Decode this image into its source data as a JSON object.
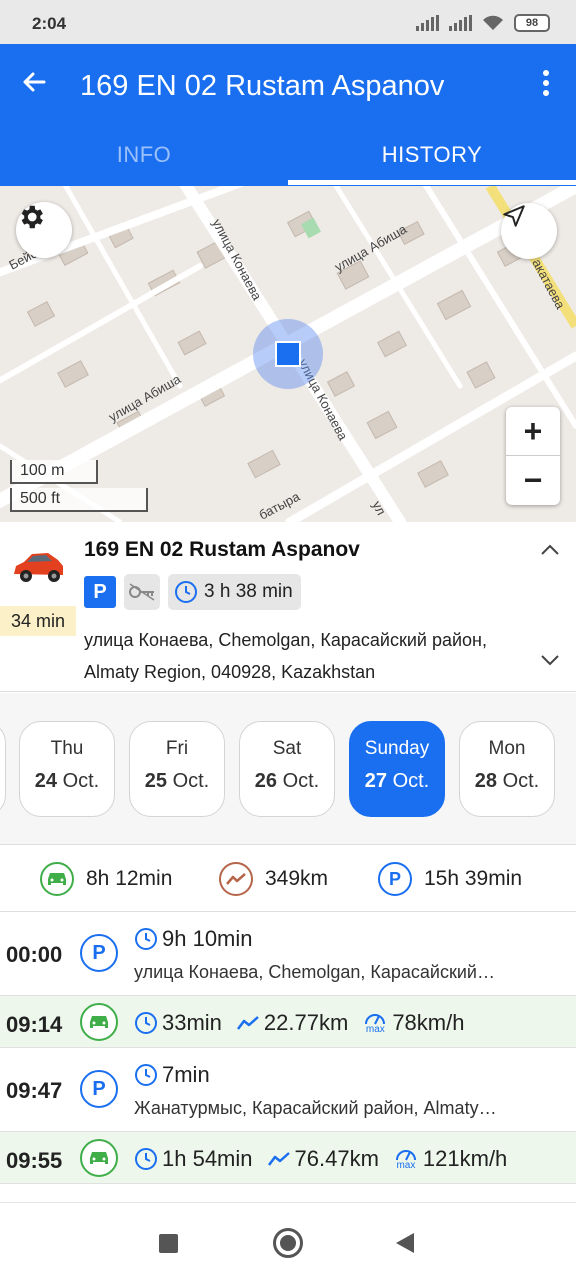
{
  "status_bar": {
    "time": "2:04",
    "battery": "98"
  },
  "app_bar": {
    "title": "169 EN 02 Rustam Aspanov",
    "tabs": [
      {
        "label": "INFO",
        "active": false
      },
      {
        "label": "HISTORY",
        "active": true
      }
    ]
  },
  "map": {
    "labels": [
      "улица Конаева",
      "улица Абиша",
      "улица Абиша",
      "улица Конаева",
      "Бейсекова",
      "акатаева",
      "батыра",
      "ул"
    ],
    "scale": {
      "metric": "100 m",
      "imperial": "500 ft"
    },
    "zoom_in": "+",
    "zoom_out": "−"
  },
  "vehicle": {
    "name": "169 EN 02 Rustam Aspanov",
    "idle_time": "34 min",
    "status": "P",
    "duration": "3 h 38 min",
    "address": "улица Конаева, Chemolgan, Карасайский район, Almaty Region, 040928, Kazakhstan"
  },
  "days": [
    {
      "name": "Thu",
      "day": "24",
      "month": "Oct.",
      "selected": false
    },
    {
      "name": "Fri",
      "day": "25",
      "month": "Oct.",
      "selected": false
    },
    {
      "name": "Sat",
      "day": "26",
      "month": "Oct.",
      "selected": false
    },
    {
      "name": "Sunday",
      "day": "27",
      "month": "Oct.",
      "selected": true
    },
    {
      "name": "Mon",
      "day": "28",
      "month": "Oct.",
      "selected": false
    }
  ],
  "summary": {
    "driving": "8h 12min",
    "distance": "349km",
    "parking": "15h 39min"
  },
  "history": [
    {
      "type": "parking",
      "time": "00:00",
      "duration": "9h 10min",
      "address": "улица Конаева, Chemolgan, Карасайский…"
    },
    {
      "type": "drive",
      "time": "09:14",
      "duration": "33min",
      "distance": "22.77km",
      "max_speed": "78km/h",
      "max_label": "max"
    },
    {
      "type": "parking",
      "time": "09:47",
      "duration": "7min",
      "address": "Жанатурмыс, Карасайский район, Almaty…"
    },
    {
      "type": "drive",
      "time": "09:55",
      "duration": "1h 54min",
      "distance": "76.47km",
      "max_speed": "121km/h",
      "max_label": "max"
    }
  ],
  "colors": {
    "primary": "#1a6ff0",
    "drive_green": "#3fae49",
    "distance_brown": "#b5654a",
    "drive_row_bg": "#edf7ec",
    "idle_bg": "#fbf0c8"
  }
}
